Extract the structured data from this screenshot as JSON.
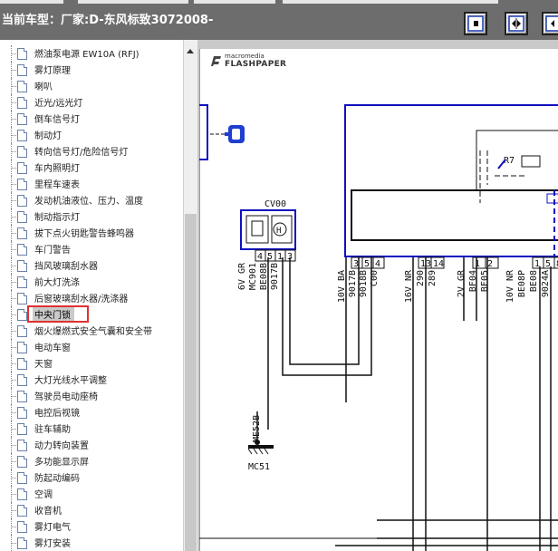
{
  "header": {
    "current_model_label": "当前车型：",
    "current_model_value": "厂家:D-东风标致3072008-"
  },
  "toolbar": {
    "buttons": [
      {
        "name": "single-page-icon"
      },
      {
        "name": "two-page-icon"
      },
      {
        "name": "next-page-icon"
      }
    ]
  },
  "tree": {
    "items": [
      {
        "label": "燃油泵电源 EW10A (RFJ)"
      },
      {
        "label": "雾灯原理"
      },
      {
        "label": "喇叭"
      },
      {
        "label": "近光/远光灯"
      },
      {
        "label": "倒车信号灯"
      },
      {
        "label": "制动灯"
      },
      {
        "label": "转向信号灯/危险信号灯"
      },
      {
        "label": "车内照明灯"
      },
      {
        "label": "里程车速表"
      },
      {
        "label": "发动机油液位、压力、温度"
      },
      {
        "label": "制动指示灯"
      },
      {
        "label": "拔下点火钥匙警告蜂鸣器"
      },
      {
        "label": "车门警告"
      },
      {
        "label": "挡风玻璃刮水器"
      },
      {
        "label": "前大灯洗涤"
      },
      {
        "label": "后窗玻璃刮水器/洗涤器"
      },
      {
        "label": "中央门锁",
        "selected": true
      },
      {
        "label": "烟火爆燃式安全气囊和安全带"
      },
      {
        "label": "电动车窗"
      },
      {
        "label": "天窗"
      },
      {
        "label": "大灯光线水平调整"
      },
      {
        "label": "驾驶员电动座椅"
      },
      {
        "label": "电控后视镜"
      },
      {
        "label": "驻车辅助"
      },
      {
        "label": "动力转向装置"
      },
      {
        "label": "多功能显示屏"
      },
      {
        "label": "防起动编码"
      },
      {
        "label": "空调"
      },
      {
        "label": "收音机"
      },
      {
        "label": "雾灯电气"
      },
      {
        "label": "雾灯安装"
      }
    ]
  },
  "viewer": {
    "brand_line1": "macromedia",
    "brand_line2": "FLASHPAPER"
  },
  "schematic": {
    "cv00": "CV00",
    "cv_pins": [
      "4",
      "5",
      "1",
      "3"
    ],
    "cv_wires": [
      "6V GR",
      "MC901",
      "BE08B",
      "9017B"
    ],
    "r7": "R7",
    "mid_pins": [
      "3",
      "5",
      "4"
    ],
    "mid_wires": [
      "10V BA",
      "9017B",
      "9018B",
      "C00"
    ],
    "pins_b": [
      "13",
      "14"
    ],
    "wires_b": [
      "16V NR",
      "290",
      "289"
    ],
    "pins_c": [
      "1",
      "2"
    ],
    "wires_c": [
      "2V GR",
      "BF04",
      "BF05"
    ],
    "pins_d": [
      "1",
      "5",
      "8"
    ],
    "wires_d": [
      "10V NR",
      "BE08P",
      "BE08",
      "9024A"
    ],
    "ground_wire": "ME52B",
    "ground_label": "MC51"
  },
  "colors": {
    "header_bg": "#6d6d6d",
    "accent_blue": "#1010c0",
    "selection_red": "#e03030"
  }
}
